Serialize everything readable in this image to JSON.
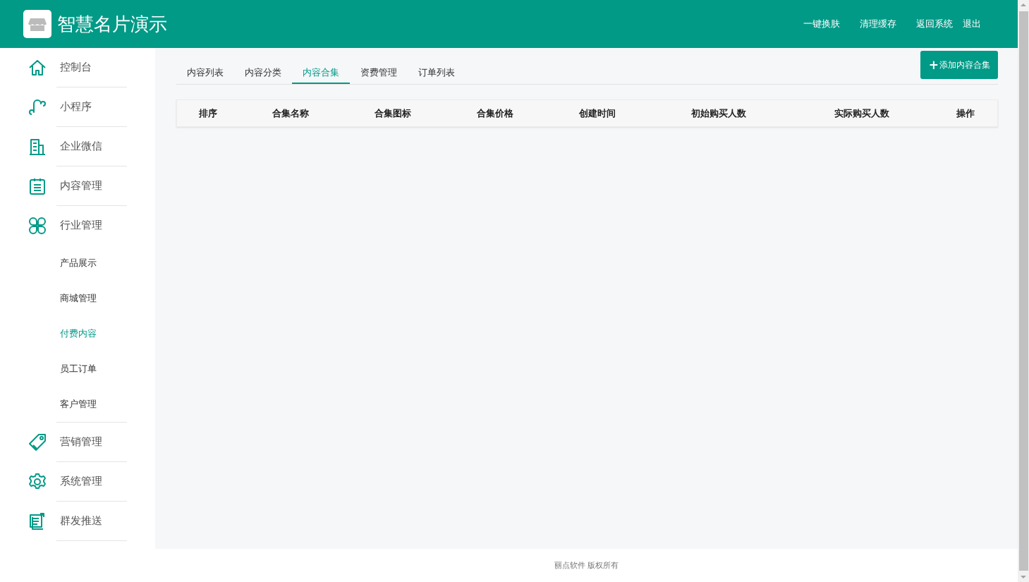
{
  "header": {
    "title": "智慧名片演示",
    "links": [
      "一键换肤",
      "清理缓存",
      "返回系统",
      "退出"
    ]
  },
  "sidebar": {
    "items": [
      {
        "label": "控制台"
      },
      {
        "label": "小程序"
      },
      {
        "label": "企业微信"
      },
      {
        "label": "内容管理"
      },
      {
        "label": "行业管理",
        "children": [
          {
            "label": "产品展示",
            "selected": false
          },
          {
            "label": "商城管理",
            "selected": false
          },
          {
            "label": "付费内容",
            "selected": true
          },
          {
            "label": "员工订单",
            "selected": false
          },
          {
            "label": "客户管理",
            "selected": false
          }
        ]
      },
      {
        "label": "营销管理"
      },
      {
        "label": "系统管理"
      },
      {
        "label": "群发推送"
      }
    ]
  },
  "tabs": [
    {
      "label": "内容列表",
      "selected": false
    },
    {
      "label": "内容分类",
      "selected": false
    },
    {
      "label": "内容合集",
      "selected": true
    },
    {
      "label": "资费管理",
      "selected": false
    },
    {
      "label": "订单列表",
      "selected": false
    }
  ],
  "add_button": {
    "icon": "+",
    "label": "添加内容合集"
  },
  "table": {
    "columns": [
      "排序",
      "合集名称",
      "合集图标",
      "合集价格",
      "创建时间",
      "初始购买人数",
      "实际购买人数",
      "操作"
    ]
  },
  "footer": "丽点软件 版权所有"
}
